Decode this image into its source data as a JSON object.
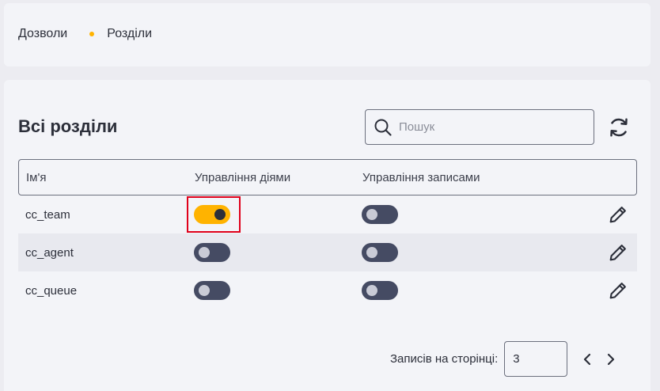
{
  "breadcrumb": {
    "items": [
      "Дозволи",
      "Розділи"
    ]
  },
  "main": {
    "title": "Всі розділи",
    "search": {
      "placeholder": "Пошук",
      "value": ""
    },
    "table": {
      "columns": [
        "Ім'я",
        "Управління діями",
        "Управління записами"
      ],
      "rows": [
        {
          "name": "cc_team",
          "actions_enabled": true,
          "records_enabled": false
        },
        {
          "name": "cc_agent",
          "actions_enabled": false,
          "records_enabled": false
        },
        {
          "name": "cc_queue",
          "actions_enabled": false,
          "records_enabled": false
        }
      ]
    },
    "pagination": {
      "label": "Записів на сторінці:",
      "per_page": "3"
    }
  },
  "colors": {
    "accent": "#ffb300",
    "toggle_off": "#454b63",
    "highlight": "#e0001a"
  },
  "icons": [
    "search-icon",
    "refresh-icon",
    "pencil-icon",
    "chevron-left-icon",
    "chevron-right-icon"
  ]
}
